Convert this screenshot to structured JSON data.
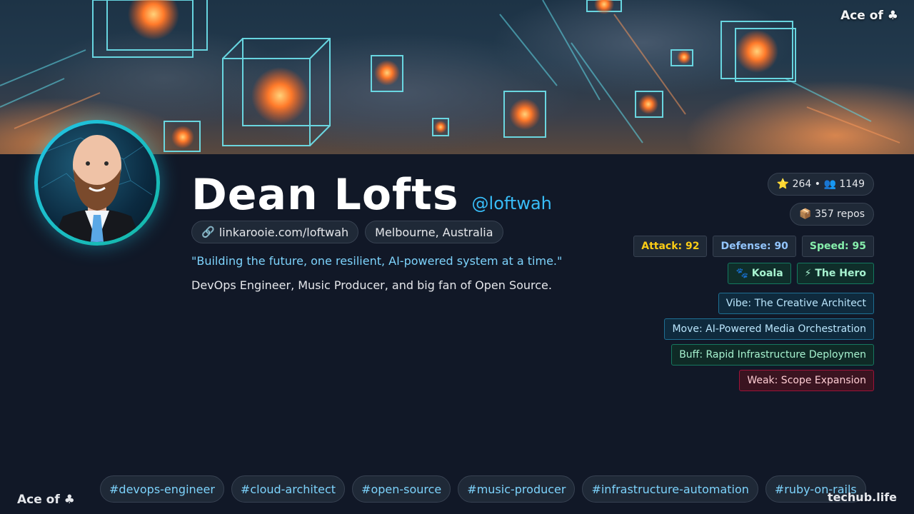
{
  "banner": {
    "brand": "Ace of ♣"
  },
  "profile": {
    "name": "Dean Lofts",
    "handle": "@loftwah",
    "website": "linkarooie.com/loftwah",
    "location": "Melbourne, Australia",
    "quote": "\"Building the future, one resilient, AI-powered system at a time.\"",
    "bio": "DevOps Engineer, Music Producer, and big fan of Open Source."
  },
  "stats": {
    "stars_followers": "⭐ 264 • 👥 1149",
    "repos": "📦 357 repos",
    "attack": "Attack: 92",
    "defense": "Defense: 90",
    "speed": "Speed: 95",
    "spirit_badge": "🐾 Koala",
    "class_badge": "⚡ The Hero",
    "vibe": "Vibe: The Creative Architect",
    "move": "Move: AI-Powered Media Orchestration",
    "buff": "Buff: Rapid Infrastructure Deploymen",
    "weak": "Weak: Scope Expansion"
  },
  "colors": {
    "attack": "#facc15",
    "defense": "#93c5fd",
    "speed": "#86efac",
    "accent": "#38bdf8",
    "background": "#111827"
  },
  "tags": [
    "#devops-engineer",
    "#cloud-architect",
    "#open-source",
    "#music-producer",
    "#infrastructure-automation",
    "#ruby-on-rails"
  ],
  "footer": {
    "brand": "Ace of ♣",
    "site": "techub.life"
  }
}
